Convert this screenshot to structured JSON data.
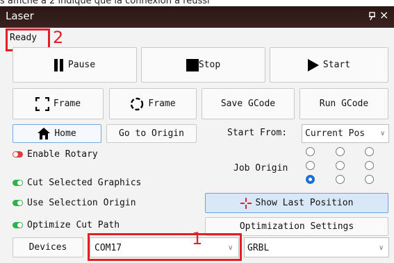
{
  "caption": "s affiche à 2 indique que la connexion a réussi",
  "window": {
    "title": "Laser",
    "pin_icon": "pin-icon",
    "close_glyph": "×"
  },
  "status": {
    "text": "Ready"
  },
  "controls": {
    "pause": "Pause",
    "stop": "Stop",
    "start": "Start"
  },
  "frame": {
    "frame1": "Frame",
    "frame2": "Frame",
    "save_gcode": "Save GCode",
    "run_gcode": "Run GCode"
  },
  "nav": {
    "home": "Home",
    "go_origin": "Go to Origin"
  },
  "start_from": {
    "label": "Start From:",
    "value": "Current Pos"
  },
  "options": {
    "enable_rotary": "Enable Rotary",
    "cut_selected": "Cut Selected Graphics",
    "use_selection_origin": "Use Selection Origin",
    "optimize_cut": "Optimize Cut Path"
  },
  "job_origin": {
    "label": "Job Origin",
    "selected_index": 6
  },
  "show_last_position": "Show Last Position",
  "optimization_settings": "Optimization Settings",
  "devices": {
    "button": "Devices",
    "port": "COM17",
    "controller": "GRBL"
  },
  "annotations": {
    "one": "1",
    "two": "2"
  },
  "colors": {
    "red_annotation": "#e31e24",
    "toggle_on": "#2db34a",
    "toggle_off": "#e03c3c",
    "radio_selected": "#1d6fd8"
  }
}
